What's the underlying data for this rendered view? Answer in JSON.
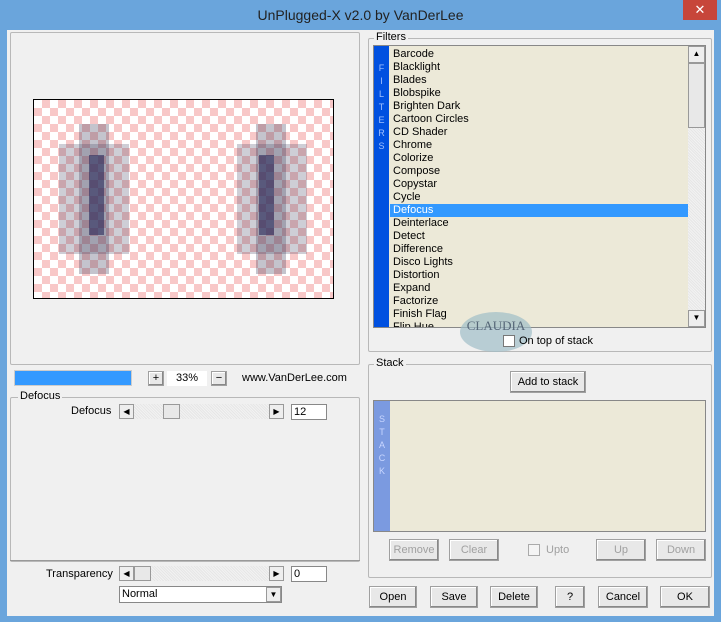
{
  "window": {
    "title": "UnPlugged-X v2.0 by VanDerLee",
    "close": "✕"
  },
  "preview": {
    "zoom": "33%",
    "plus": "+",
    "minus": "−",
    "website": "www.VanDerLee.com",
    "progress": 1.0
  },
  "filters": {
    "group_label": "Filters",
    "bar_label": "FILTERS",
    "items": [
      "Barcode",
      "Blacklight",
      "Blades",
      "Blobspike",
      "Brighten Dark",
      "Cartoon Circles",
      "CD Shader",
      "Chrome",
      "Colorize",
      "Compose",
      "Copystar",
      "Cycle",
      "Defocus",
      "Deinterlace",
      "Detect",
      "Difference",
      "Disco Lights",
      "Distortion",
      "Expand",
      "Factorize",
      "Finish Flag",
      "Flip Hue"
    ],
    "selected": "Defocus",
    "on_top_label": "On top of stack",
    "on_top_checked": false
  },
  "params": {
    "group_label": "Defocus",
    "slider_label": "Defocus",
    "slider_value": "12",
    "transparency_label": "Transparency",
    "transparency_value": "0",
    "blend_mode": "Normal"
  },
  "stack": {
    "group_label": "Stack",
    "add": "Add to stack",
    "bar_label": "STACK",
    "remove": "Remove",
    "clear": "Clear",
    "upto": "Upto",
    "up": "Up",
    "down": "Down"
  },
  "footer": {
    "open": "Open",
    "save": "Save",
    "delete": "Delete",
    "help": "?",
    "cancel": "Cancel",
    "ok": "OK"
  },
  "watermark": "CLAUDIA"
}
